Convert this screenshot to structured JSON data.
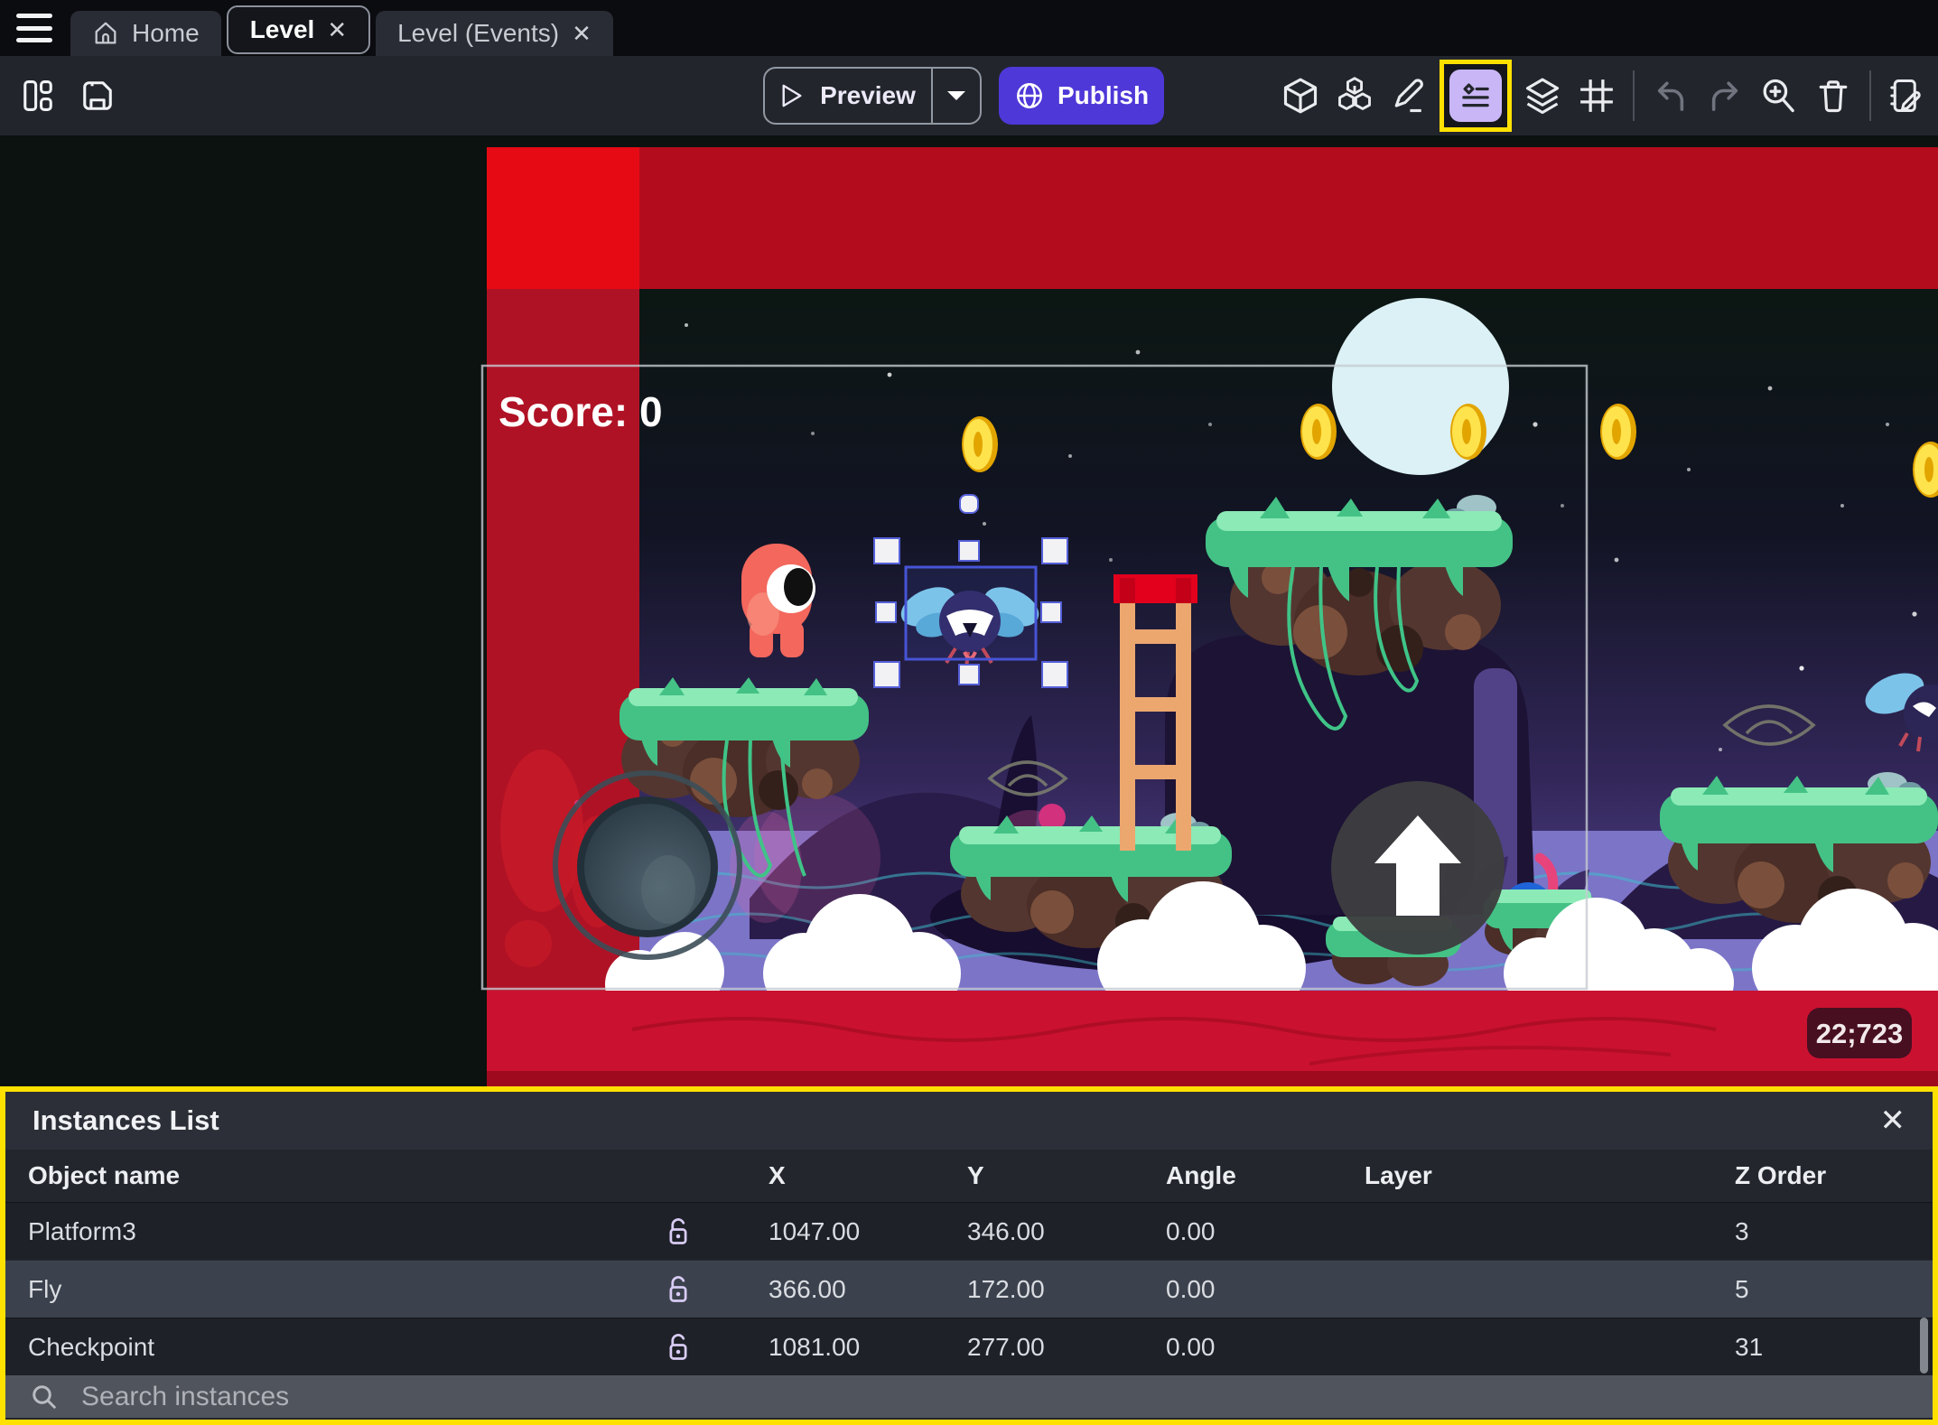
{
  "colors": {
    "highlight_yellow": "#ffe100",
    "publish_purple": "#4e38d8",
    "selection_blue": "#4754d6",
    "active_tool_bg": "#c9b6f6",
    "tab_bar_bg": "#0a0c0f",
    "toolbar_bg": "#22252c",
    "panel_bg": "#22252c"
  },
  "tab_bar": {
    "close_glyph": "✕",
    "tabs": [
      {
        "label": "Home"
      },
      {
        "label": "Level"
      },
      {
        "label": "Level (Events)"
      }
    ]
  },
  "toolbar": {
    "preview_label": "Preview",
    "publish_label": "Publish",
    "left_icons": [
      "layout-panels",
      "save"
    ],
    "right_icons": [
      "object-cube",
      "objects-stack",
      "edit-pencil",
      "instances-list",
      "layers",
      "grid",
      "undo",
      "redo",
      "zoom-in",
      "trash",
      "edit-properties"
    ],
    "active_icon": "instances-list"
  },
  "scene": {
    "score_label": "Score: 0",
    "coordinates_badge": "22;723",
    "selected_instance": "Fly"
  },
  "instances_panel": {
    "title": "Instances List",
    "close_glyph": "✕",
    "columns": [
      "Object name",
      "X",
      "Y",
      "Angle",
      "Layer",
      "Z Order"
    ],
    "rows": [
      {
        "name": "Platform3",
        "locked": false,
        "x": "1047.00",
        "y": "346.00",
        "angle": "0.00",
        "layer": "",
        "z_order": "3",
        "selected": false
      },
      {
        "name": "Fly",
        "locked": false,
        "x": "366.00",
        "y": "172.00",
        "angle": "0.00",
        "layer": "",
        "z_order": "5",
        "selected": true
      },
      {
        "name": "Checkpoint",
        "locked": false,
        "x": "1081.00",
        "y": "277.00",
        "angle": "0.00",
        "layer": "",
        "z_order": "31",
        "selected": false
      }
    ],
    "search_placeholder": "Search instances"
  }
}
